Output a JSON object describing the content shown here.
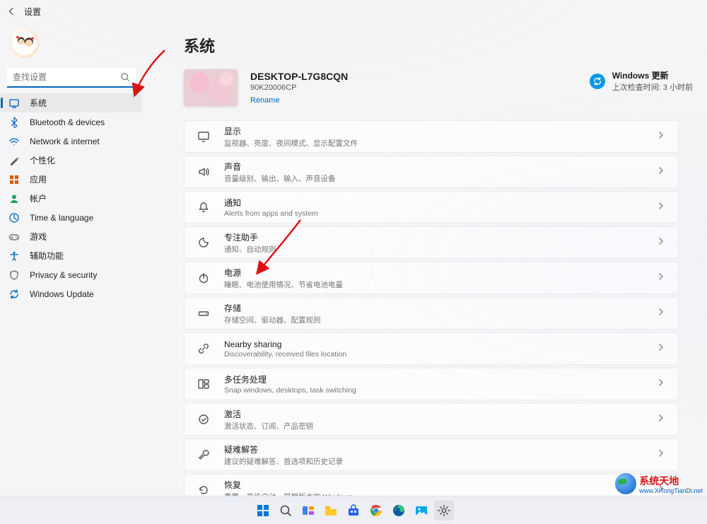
{
  "titlebar": {
    "title": "设置"
  },
  "search": {
    "placeholder": "查找设置"
  },
  "sidebar": {
    "items": [
      {
        "label": "系统",
        "icon": "system",
        "color": "#1976d2"
      },
      {
        "label": "Bluetooth & devices",
        "icon": "bluetooth",
        "color": "#1976d2"
      },
      {
        "label": "Network & internet",
        "icon": "wifi",
        "color": "#1976d2"
      },
      {
        "label": "个性化",
        "icon": "personalize",
        "color": "#5c5c5c"
      },
      {
        "label": "应用",
        "icon": "apps",
        "color": "#e05a00"
      },
      {
        "label": "帐户",
        "icon": "account",
        "color": "#18a558"
      },
      {
        "label": "Time & language",
        "icon": "time",
        "color": "#1976d2"
      },
      {
        "label": "游戏",
        "icon": "gaming",
        "color": "#7a7a7a"
      },
      {
        "label": "辅助功能",
        "icon": "accessibility",
        "color": "#0a74c2"
      },
      {
        "label": "Privacy & security",
        "icon": "privacy",
        "color": "#7a7a7a"
      },
      {
        "label": "Windows Update",
        "icon": "update",
        "color": "#0a74c2"
      }
    ]
  },
  "page": {
    "title": "系统",
    "device": {
      "name": "DESKTOP-L7G8CQN",
      "model": "90K20006CP",
      "rename": "Rename"
    },
    "update": {
      "title": "Windows 更新",
      "subtitle": "上次检查时间: 3 小时前"
    },
    "cards": [
      {
        "icon": "display",
        "title": "显示",
        "sub": "监视器、亮度、夜间模式、显示配置文件"
      },
      {
        "icon": "sound",
        "title": "声音",
        "sub": "音量级别、输出、输入、声音设备"
      },
      {
        "icon": "notify",
        "title": "通知",
        "sub": "Alerts from apps and system"
      },
      {
        "icon": "focus",
        "title": "专注助手",
        "sub": "通知、自动规则"
      },
      {
        "icon": "power",
        "title": "电源",
        "sub": "睡眠、电池使用情况、节省电池电量"
      },
      {
        "icon": "storage",
        "title": "存储",
        "sub": "存储空间、驱动器、配置规则"
      },
      {
        "icon": "share",
        "title": "Nearby sharing",
        "sub": "Discoverability, received files location"
      },
      {
        "icon": "multitask",
        "title": "多任务处理",
        "sub": "Snap windows, desktops, task switching"
      },
      {
        "icon": "activate",
        "title": "激活",
        "sub": "激活状态、订阅、产品密钥"
      },
      {
        "icon": "troubleshoot",
        "title": "疑难解答",
        "sub": "建议的疑难解答、首选项和历史记录"
      },
      {
        "icon": "recovery",
        "title": "恢复",
        "sub": "重置、高级启动、早期版本的 Windows"
      }
    ]
  },
  "watermark": {
    "brand": "系统天地",
    "url": "www.XiTongTianDi.net"
  },
  "taskbar": {
    "items": [
      "start",
      "search",
      "taskview",
      "explorer",
      "store",
      "settings",
      "chrome",
      "edge",
      "photos",
      "settings2"
    ]
  }
}
